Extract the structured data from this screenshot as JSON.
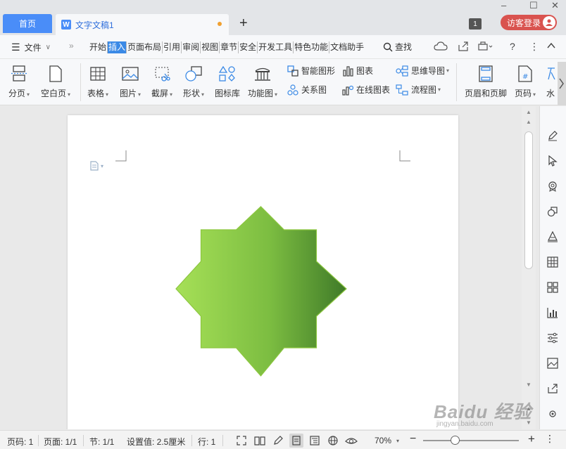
{
  "tabs": {
    "home": "首页",
    "doc_title": "文字文稿1",
    "add": "+"
  },
  "window": {
    "minimize": "–",
    "maximize": "☐",
    "close": "✕",
    "badge": "1",
    "login": "访客登录"
  },
  "menu": {
    "file": "文件",
    "more": "»",
    "tabs": [
      "开始",
      "插入",
      "页面布局",
      "引用",
      "审阅",
      "视图",
      "章节",
      "安全",
      "开发工具",
      "特色功能",
      "文档助手"
    ],
    "active_tab": "插入",
    "search": "查找"
  },
  "ribbon": {
    "page_break": "分页",
    "blank_page": "空白页",
    "table": "表格",
    "picture": "图片",
    "screenshot": "截屏",
    "shape": "形状",
    "icon_lib": "图标库",
    "function_chart": "功能图",
    "smart_shape": "智能图形",
    "chart": "图表",
    "mind_map": "思维导图",
    "relation_chart": "关系图",
    "online_chart": "在线图表",
    "flowchart": "流程图",
    "header_footer": "页眉和页脚",
    "page_number": "页码",
    "watermark": "水"
  },
  "status": {
    "page_num": "页码: 1",
    "pages": "页面: 1/1",
    "section": "节: 1/1",
    "setting": "设置值: 2.5厘米",
    "row": "行: 1",
    "zoom": "70%"
  },
  "shape": {
    "type": "8-point star",
    "gradient_start": "#a6e057",
    "gradient_end": "#3f7a28",
    "stroke": "#8cc63f"
  },
  "overlay": {
    "brand": "Baidu 经验",
    "url": "jingyan.baidu.com"
  },
  "colors": {
    "accent": "#4a8df8",
    "active_tab": "#3b8ae6",
    "login": "#d9534f"
  }
}
